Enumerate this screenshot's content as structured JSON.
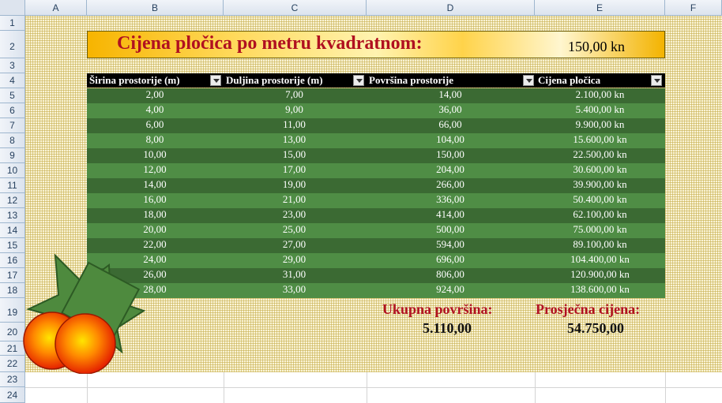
{
  "columns": [
    "A",
    "B",
    "C",
    "D",
    "E",
    "F"
  ],
  "rows": [
    "1",
    "2",
    "3",
    "4",
    "5",
    "6",
    "7",
    "8",
    "9",
    "10",
    "11",
    "12",
    "13",
    "14",
    "15",
    "16",
    "17",
    "18",
    "19",
    "20",
    "21",
    "22",
    "23",
    "24"
  ],
  "banner": {
    "title": "Cijena pločica po metru kvadratnom:",
    "price": "150,00 kn"
  },
  "table": {
    "headers": [
      "Širina prostorije (m)",
      "Duljina prostorije (m)",
      "Površina prostorije",
      "Cijena pločica"
    ],
    "rows": [
      [
        "2,00",
        "7,00",
        "14,00",
        "2.100,00 kn"
      ],
      [
        "4,00",
        "9,00",
        "36,00",
        "5.400,00 kn"
      ],
      [
        "6,00",
        "11,00",
        "66,00",
        "9.900,00 kn"
      ],
      [
        "8,00",
        "13,00",
        "104,00",
        "15.600,00 kn"
      ],
      [
        "10,00",
        "15,00",
        "150,00",
        "22.500,00 kn"
      ],
      [
        "12,00",
        "17,00",
        "204,00",
        "30.600,00 kn"
      ],
      [
        "14,00",
        "19,00",
        "266,00",
        "39.900,00 kn"
      ],
      [
        "16,00",
        "21,00",
        "336,00",
        "50.400,00 kn"
      ],
      [
        "18,00",
        "23,00",
        "414,00",
        "62.100,00 kn"
      ],
      [
        "20,00",
        "25,00",
        "500,00",
        "75.000,00 kn"
      ],
      [
        "22,00",
        "27,00",
        "594,00",
        "89.100,00 kn"
      ],
      [
        "24,00",
        "29,00",
        "696,00",
        "104.400,00 kn"
      ],
      [
        "26,00",
        "31,00",
        "806,00",
        "120.900,00 kn"
      ],
      [
        "28,00",
        "33,00",
        "924,00",
        "138.600,00 kn"
      ]
    ]
  },
  "totals": {
    "area_label": "Ukupna površina:",
    "area_value": "5.110,00",
    "price_label": "Prosječna cijena:",
    "price_value": "54.750,00"
  },
  "colors": {
    "title": "#b01020",
    "row_dark": "#3b6a33",
    "row_light": "#4f8d45",
    "shape_green": "#4e8a3e"
  }
}
